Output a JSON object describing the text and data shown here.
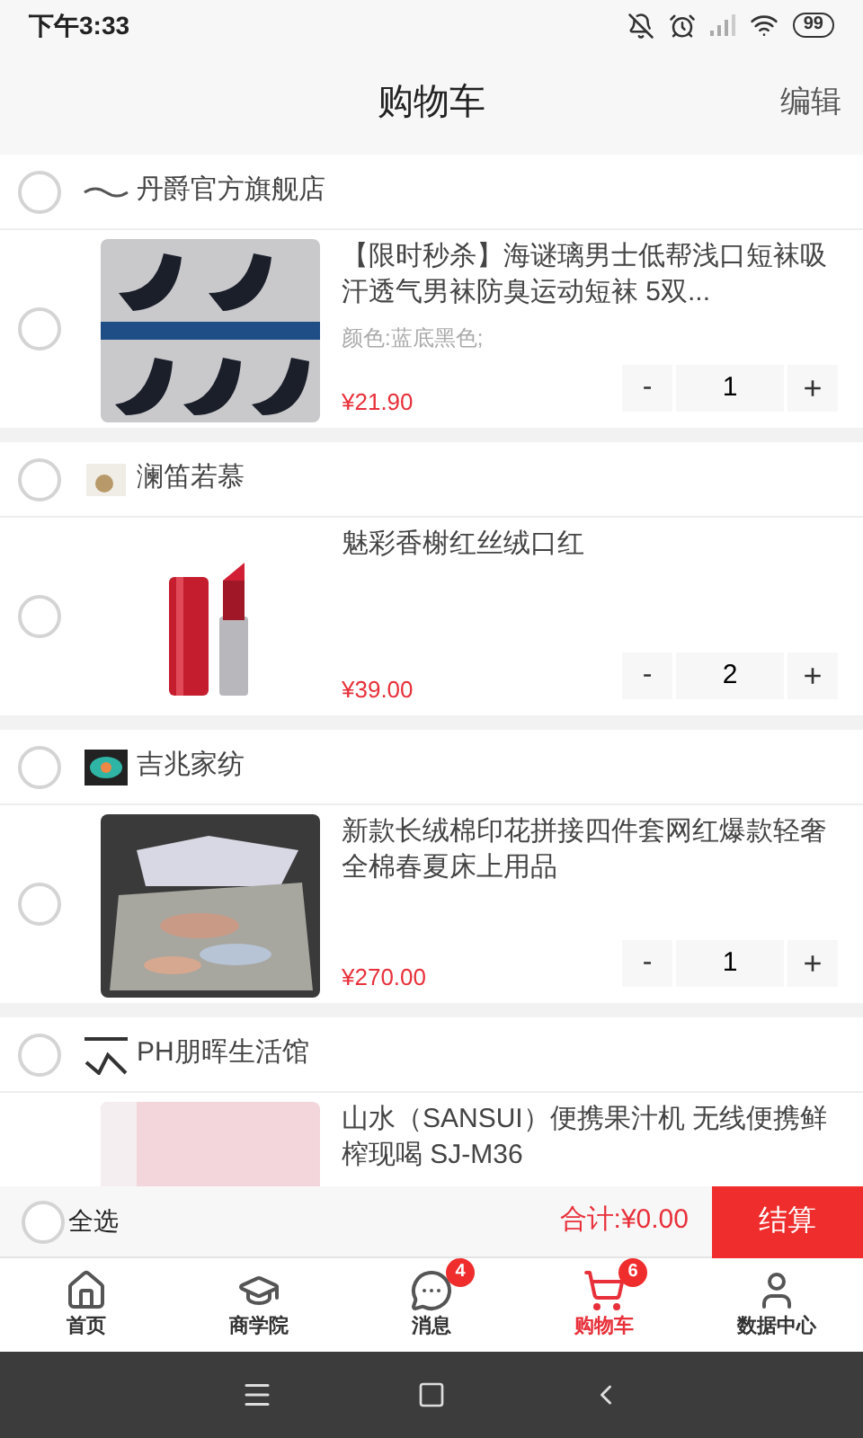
{
  "status_bar": {
    "time": "下午3:33",
    "battery": "99"
  },
  "header": {
    "title": "购物车",
    "action": "编辑"
  },
  "stores": [
    {
      "name": "丹爵官方旗舰店",
      "checked": false,
      "items": [
        {
          "title": "【限时秒杀】海谜璃男士低帮浅口短袜吸汗透气男袜防臭运动短袜 5双...",
          "spec": "颜色:蓝底黑色;",
          "price": "¥21.90",
          "quantity": "1",
          "minus": "-",
          "plus": "+",
          "checked": false,
          "kind": "socks"
        }
      ]
    },
    {
      "name": "澜笛若慕",
      "checked": false,
      "items": [
        {
          "title": "魅彩香榭红丝绒口红",
          "price": "¥39.00",
          "quantity": "2",
          "minus": "-",
          "plus": "+",
          "checked": false,
          "kind": "lipstick"
        }
      ]
    },
    {
      "name": "吉兆家纺",
      "checked": false,
      "items": [
        {
          "title": "新款长绒棉印花拼接四件套网红爆款轻奢全棉春夏床上用品",
          "price": "¥270.00",
          "quantity": "1",
          "minus": "-",
          "plus": "+",
          "checked": false,
          "kind": "bedding"
        }
      ]
    },
    {
      "name": "PH朋晖生活馆",
      "checked": false,
      "items": [
        {
          "title": "山水（SANSUI）便携果汁机 无线便携鲜榨现喝  SJ-M36",
          "kind": "juicer"
        }
      ]
    }
  ],
  "footer": {
    "select_all": {
      "label": "全选",
      "checked": false
    },
    "total": "合计:¥0.00",
    "checkout": "结算"
  },
  "tabs": [
    {
      "label": "首页",
      "selected": false,
      "kind": "home"
    },
    {
      "label": "商学院",
      "selected": false,
      "kind": "school"
    },
    {
      "label": "消息",
      "selected": false,
      "kind": "message",
      "badge": "4"
    },
    {
      "label": "购物车",
      "selected": true,
      "kind": "cart",
      "badge": "6"
    },
    {
      "label": "数据中心",
      "selected": false,
      "kind": "user"
    }
  ]
}
